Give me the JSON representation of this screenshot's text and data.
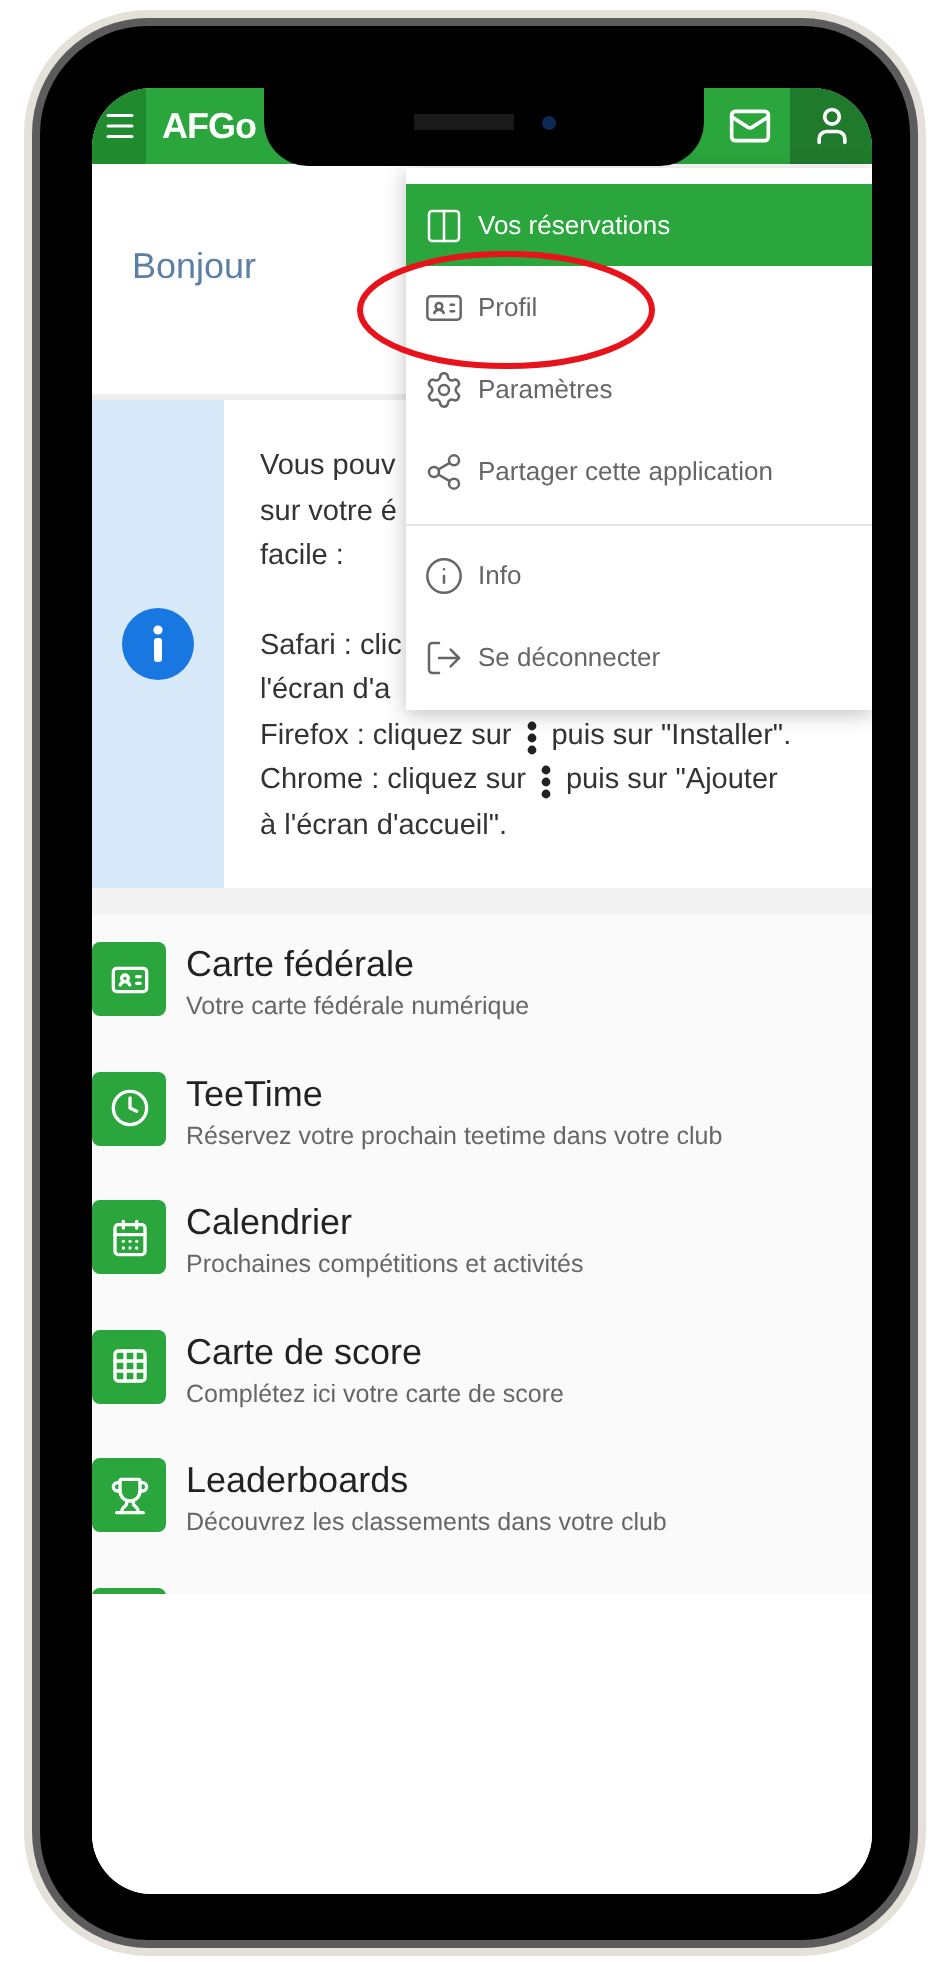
{
  "header": {
    "title": "AFGo"
  },
  "user_menu": {
    "groups": [
      [
        {
          "kind": "reservations",
          "label": "Vos réservations",
          "selected": true
        },
        {
          "kind": "profile",
          "label": "Profil",
          "selected": false
        },
        {
          "kind": "settings",
          "label": "Paramètres",
          "selected": false
        },
        {
          "kind": "share",
          "label": "Partager cette application",
          "selected": false
        }
      ],
      [
        {
          "kind": "info",
          "label": "Info",
          "selected": false
        },
        {
          "kind": "logout",
          "label": "Se déconnecter",
          "selected": false
        }
      ]
    ]
  },
  "greeting": "Bonjour",
  "install_notice": {
    "paragraphs": [
      [
        [
          {
            "kind": "text",
            "text": "Vous pouv"
          }
        ],
        [
          {
            "kind": "text",
            "text": "sur votre é"
          }
        ],
        [
          {
            "kind": "text",
            "text": "facile :"
          }
        ]
      ],
      [
        [
          {
            "kind": "text",
            "text": "Safari : clic"
          }
        ],
        [
          {
            "kind": "text",
            "text": "l'écran d'a"
          }
        ],
        [
          {
            "kind": "text",
            "text": "Firefox : cliquez sur"
          },
          {
            "kind": "dots"
          },
          {
            "kind": "text",
            "text": "puis sur \"Installer\"."
          }
        ],
        [
          {
            "kind": "text",
            "text": "Chrome : cliquez sur"
          },
          {
            "kind": "dots"
          },
          {
            "kind": "text",
            "text": "puis sur \"Ajouter"
          }
        ],
        [
          {
            "kind": "text",
            "text": "à l'écran d'accueil\"."
          }
        ]
      ]
    ]
  },
  "features": [
    {
      "kind": "card",
      "title": "Carte fédérale",
      "subtitle": "Votre carte fédérale numérique"
    },
    {
      "kind": "clock",
      "title": "TeeTime",
      "subtitle": "Réservez votre prochain teetime dans votre club"
    },
    {
      "kind": "calendar",
      "title": "Calendrier",
      "subtitle": "Prochaines compétitions et activités"
    },
    {
      "kind": "grid",
      "title": "Carte de score",
      "subtitle": "Complétez ici votre carte de score"
    },
    {
      "kind": "trophy",
      "title": "Leaderboards",
      "subtitle": "Découvrez les classements dans votre club"
    }
  ]
}
